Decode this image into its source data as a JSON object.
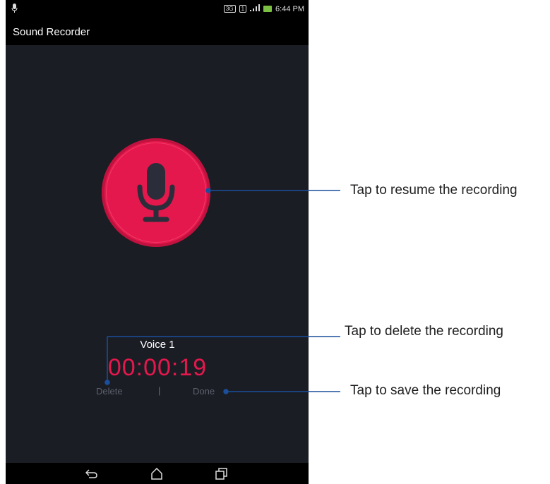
{
  "status_bar": {
    "badge_3g": "3G",
    "badge_sim": "1",
    "time": "6:44 PM"
  },
  "app": {
    "title": "Sound Recorder"
  },
  "recording": {
    "name": "Voice 1",
    "timer": "00:00:19"
  },
  "actions": {
    "delete_label": "Delete",
    "separator": "|",
    "done_label": "Done"
  },
  "callouts": {
    "resume": "Tap to resume the recording",
    "delete": "Tap to delete the recording",
    "save": "Tap to save the recording"
  },
  "colors": {
    "accent": "#e5184d",
    "background": "#1b1d24",
    "callout_line": "#1b4f9c"
  }
}
